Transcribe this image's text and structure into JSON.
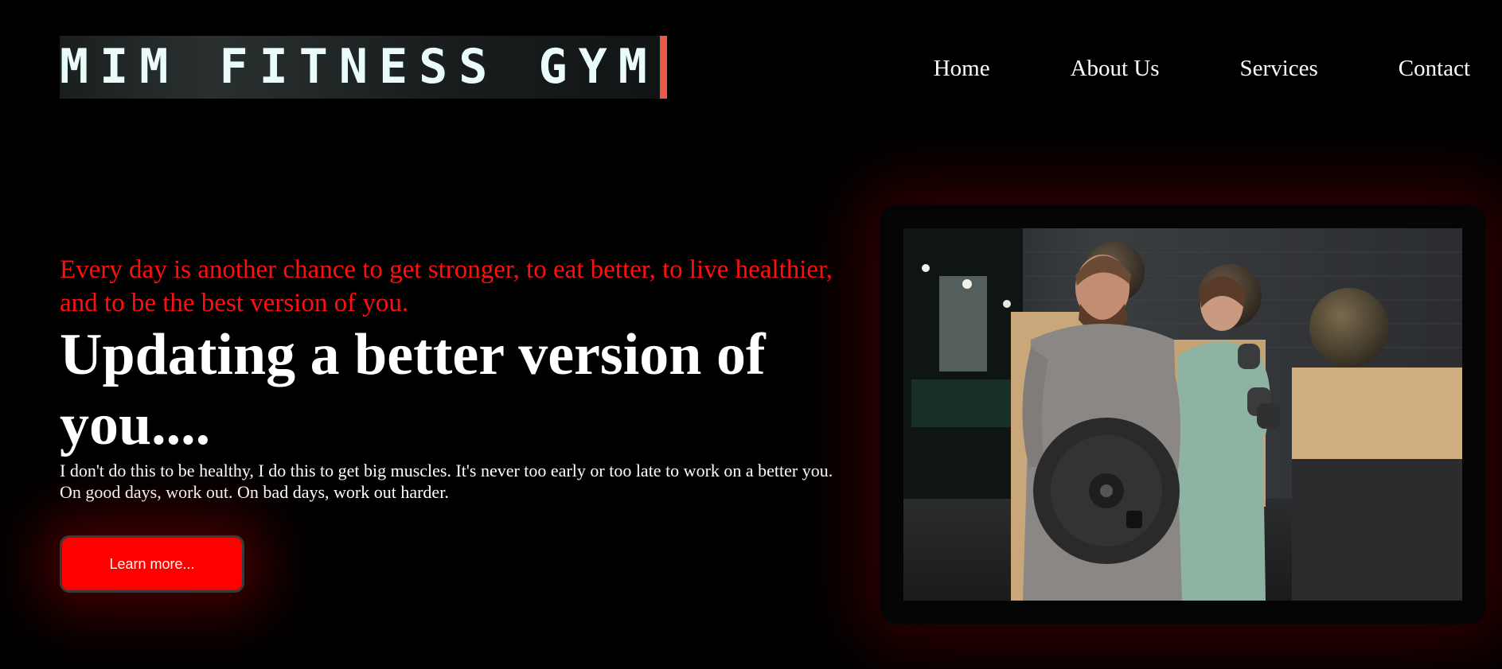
{
  "header": {
    "logo": "MIM FITNESS GYM",
    "nav": [
      "Home",
      "About Us",
      "Services",
      "Contact"
    ]
  },
  "hero": {
    "tagline": "Every day is another chance to get stronger, to eat better, to live healthier, and to be the best version of you.",
    "headline": "Updating a better version of you....",
    "body": "I don't do this to be healthy, I do this to get big muscles. It's never too early or too late to work on a better you. On good days, work out. On bad days, work out harder.",
    "button_label": "Learn more..."
  },
  "colors": {
    "background": "#000000",
    "accent": "#ff0000",
    "tagline": "#ff1010",
    "logo_cursor": "#ea5a49",
    "text": "#ffffff"
  }
}
